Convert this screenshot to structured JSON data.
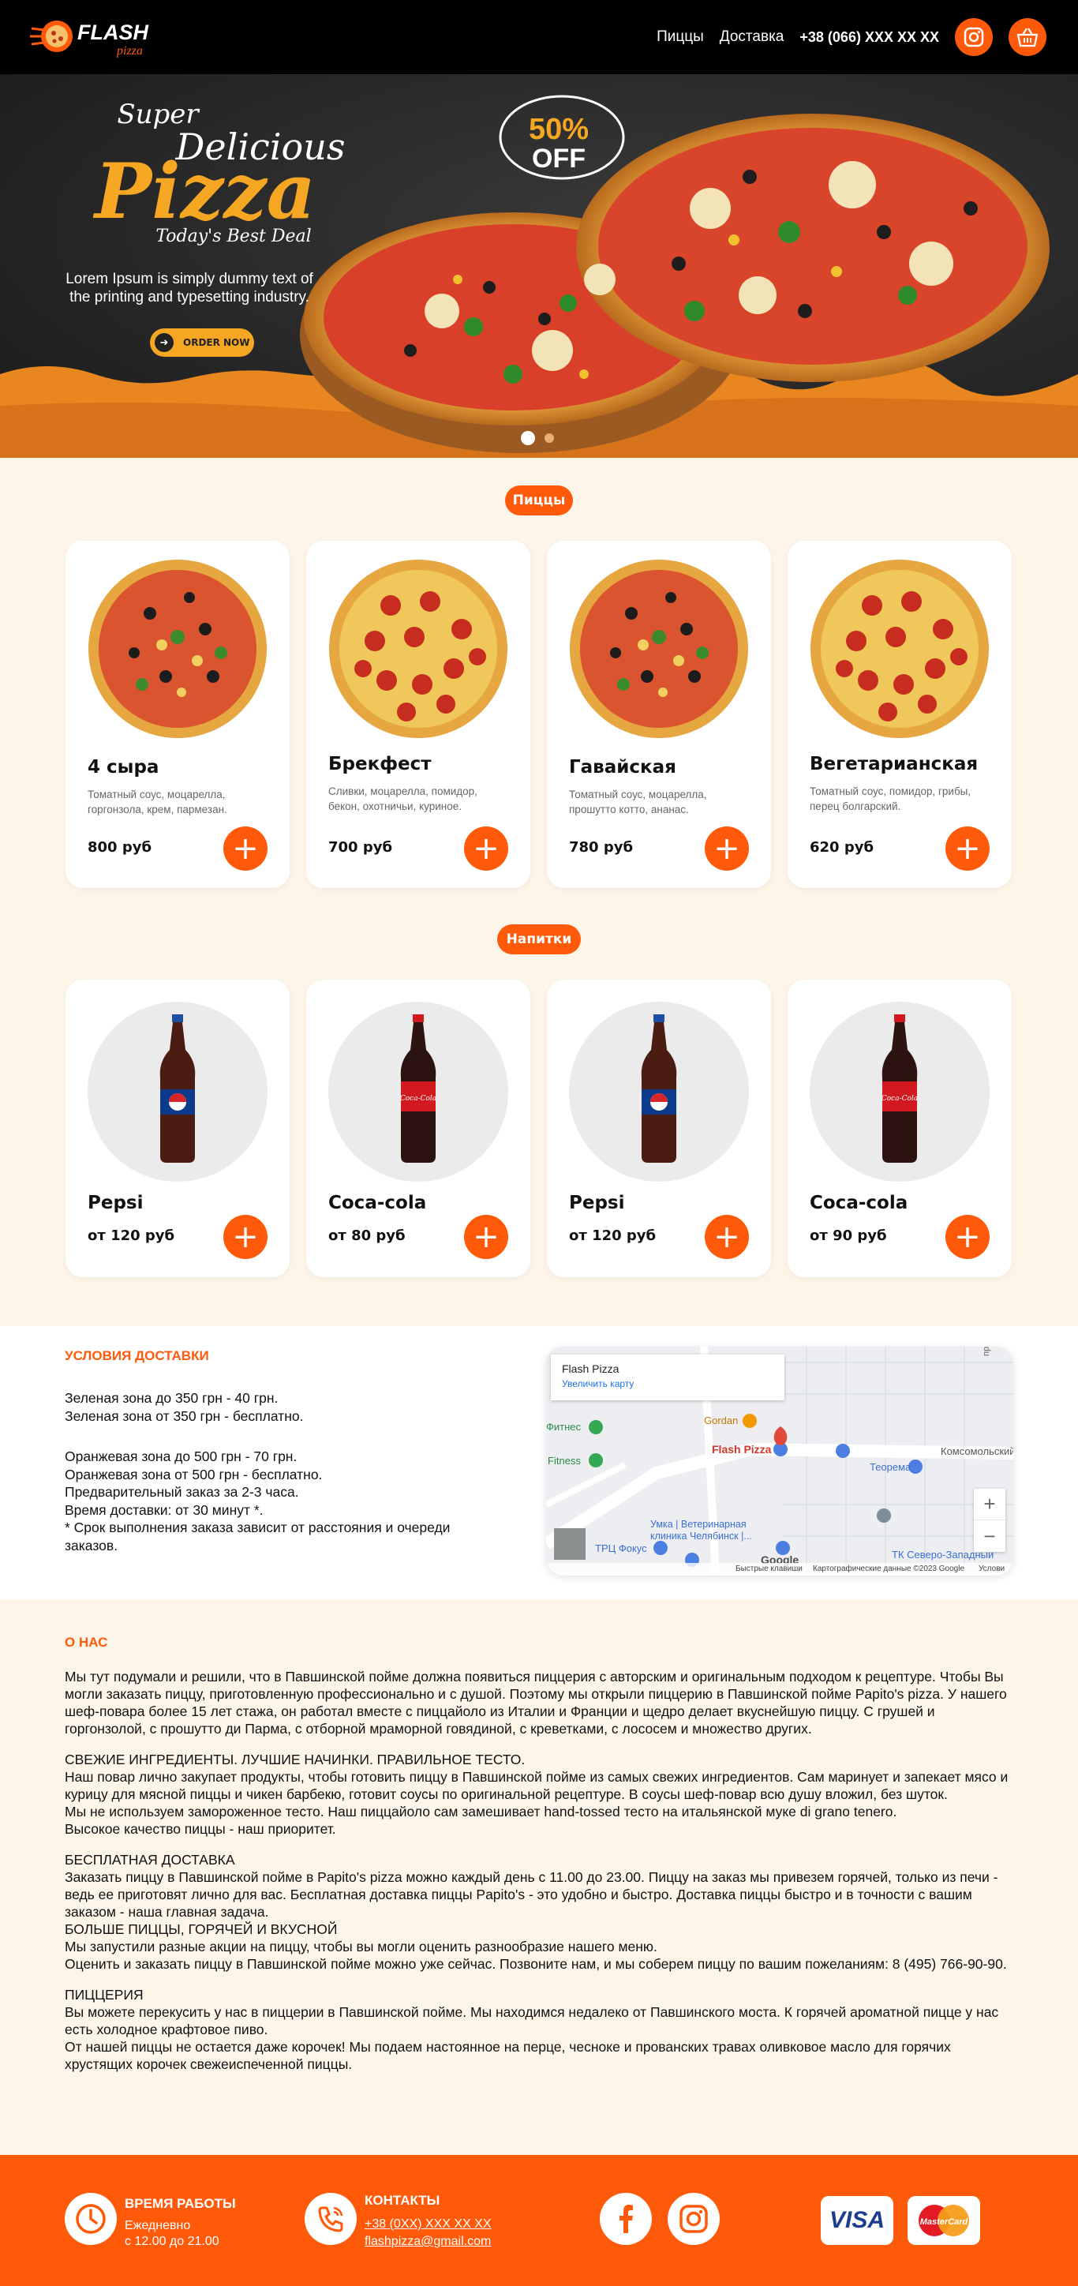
{
  "header": {
    "logo_main": "FLASH",
    "logo_sub": "pizza",
    "nav_pizzas": "Пиццы",
    "nav_delivery": "Доставка",
    "phone": "+38 (066) XXX XX XX"
  },
  "hero": {
    "super": "Super",
    "delicious": "Delicious",
    "pizza": "Pizza",
    "deal": "Today's Best Deal",
    "badge_percent": "50%",
    "badge_off": "OFF",
    "text": "Lorem Ipsum is simply dummy text of the printing and typesetting industry.",
    "order_btn": "ORDER NOW"
  },
  "pizzas": {
    "tag": "Пиццы",
    "items": [
      {
        "title": "4 сыра",
        "desc": "Томатный соус, моцарелла, горгонзола, крем, пармезан.",
        "price": "800 руб",
        "kind": "veg"
      },
      {
        "title": "Брекфест",
        "desc": "Сливки, моцарелла, помидор, бекон, охотничьи, куриное.",
        "price": "700 руб",
        "kind": "pepperoni"
      },
      {
        "title": "Гавайская",
        "desc": "Томатный соус, моцарелла, прошутто котто, ананас.",
        "price": "780 руб",
        "kind": "veg"
      },
      {
        "title": "Вегетарианская",
        "desc": "Томатный соус, помидор, грибы, перец болгарский.",
        "price": "620 руб",
        "kind": "pepperoni"
      }
    ]
  },
  "drinks": {
    "tag": "Напитки",
    "items": [
      {
        "title": "Pepsi",
        "price": "от 120 руб",
        "brand": "pepsi"
      },
      {
        "title": "Coca-cola",
        "price": "от 80 руб",
        "brand": "coca-cola"
      },
      {
        "title": "Pepsi",
        "price": "от 120 руб",
        "brand": "pepsi"
      },
      {
        "title": "Coca-cola",
        "price": "от 90 руб",
        "brand": "coca-cola"
      }
    ]
  },
  "delivery": {
    "heading": "УСЛОВИЯ ДОСТАВКИ",
    "lines": [
      "Зеленая зона до 350 грн - 40 грн.",
      "Зеленая зона от 350 грн - бесплатно.",
      "",
      "",
      "Оранжевая зона до 500 грн - 70 грн.",
      "Оранжевая зона от 500 грн - бесплатно.",
      "Предварительный заказ за 2-3 часа.",
      "Время доставки: от 30 минут *.",
      "* Срок выполнения заказа зависит от расстояния и очереди заказов."
    ]
  },
  "map": {
    "place": "Flash Pizza",
    "enlarge": "Увеличить карту",
    "marker_label": "Flash Pizza",
    "labels": [
      "Фитнес",
      "Fitness",
      "Gordan",
      "Комсомольский",
      "Теорема",
      "Умка | Ветеринарная клиника Челябинск |...",
      "ТРЦ Фокус",
      "ТК Северо-Западный",
      "пр. Сое"
    ],
    "footer_keys": "Быстрые клавиши",
    "footer_data": "Картографические данные ©2023 Google",
    "footer_terms": "Услови",
    "google": "Google"
  },
  "about": {
    "heading": "О НАС",
    "paragraphs": [
      "Мы тут подумали и решили, что в Павшинской пойме должна появиться пиццерия с авторским и оригинальным подходом к рецептуре. Чтобы Вы могли заказать пиццу, приготовленную профессионально и с душой. Поэтому мы открыли пиццерию в Павшинской пойме Papito's pizza. У нашего шеф-повара более 15 лет стажа, он работал вместе с пиццайоло из Италии и Франции и щедро делает вкуснейшую пиццу. С грушей и горгонзолой, с прошутто ди Парма, с отборной мраморной говядиной, с креветками, с лососем и множество других.",
      "",
      "СВЕЖИЕ ИНГРЕДИЕНТЫ. ЛУЧШИЕ НАЧИНКИ. ПРАВИЛЬНОЕ ТЕСТО.",
      "Наш повар лично закупает продукты, чтобы готовить пиццу в Павшинской пойме из самых свежих ингредиентов. Сам маринует и запекает мясо и курицу для мясной пиццы и чикен барбекю, готовит соусы по оригинальной рецептуре. В соусы шеф-повар всю душу вложил, без шуток.",
      "Мы не используем замороженное тесто. Наш пиццайоло сам замешивает hand-tossed тесто на итальянской муке di grano tenero.",
      "Высокое качество пиццы - наш приоритет.",
      "",
      "БЕСПЛАТНАЯ ДОСТАВКА",
      "Заказать пиццу в Павшинской пойме в Papito's pizza можно каждый день с 11.00 до 23.00. Пиццу на заказ мы привезем горячей, только из печи - ведь ее приготовят лично для вас. Бесплатная доставка пиццы Papito's - это удобно и быстро. Доставка пиццы быстро и в точности с вашим заказом - наша главная задача.",
      "БОЛЬШЕ ПИЦЦЫ, ГОРЯЧЕЙ И ВКУСНОЙ",
      "Мы запустили разные акции на пиццу, чтобы вы могли оценить разнообразие нашего меню.",
      "Оценить и заказать пиццу в Павшинской пойме можно уже сейчас. Позвоните нам, и мы соберем пиццу по вашим пожеланиям: 8 (495) 766-90-90.",
      "",
      "ПИЦЦЕРИЯ",
      "Вы можете перекусить у нас в пиццерии в Павшинской пойме. Мы находимся недалеко от Павшинского моста. К горячей ароматной пицце у нас есть холодное крафтовое пиво.",
      "От нашей пиццы не остается даже корочек! Мы подаем настоянное на перце, чесноке и прованских травах оливковое масло для горячих хрустящих корочек свежеиспеченной пиццы."
    ]
  },
  "footer": {
    "hours_title": "ВРЕМЯ РАБОТЫ",
    "hours_line1": "Ежедневно",
    "hours_line2": "с 12.00 до 21.00",
    "contacts_title": "КОНТАКТЫ",
    "contacts_phone": "+38 (0XX) XXX XX XX",
    "contacts_email": "flashpizza@gmail.com",
    "visa": "VISA",
    "mastercard": "MasterCard"
  },
  "colors": {
    "accent": "#ff5a0a",
    "background": "#fdf6e8",
    "header": "#000000"
  }
}
